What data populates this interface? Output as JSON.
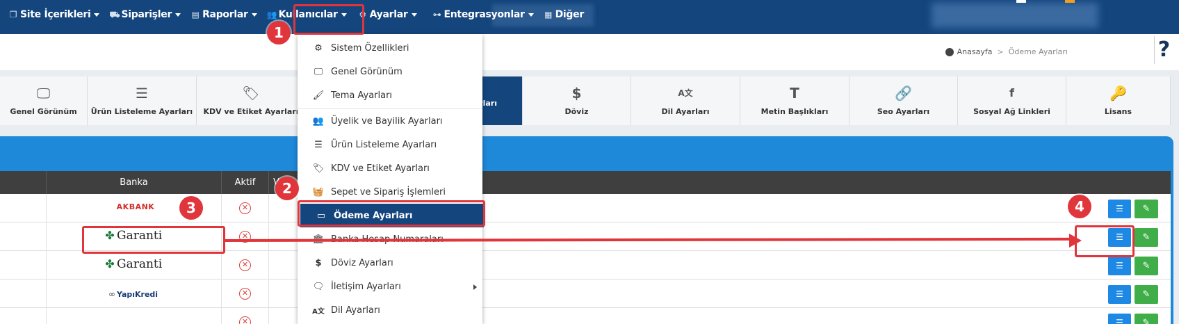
{
  "nav": {
    "items": [
      {
        "label": "Site İçerikleri",
        "icon": "copy-icon"
      },
      {
        "label": "Siparişler",
        "icon": "truck-icon"
      },
      {
        "label": "Raporlar",
        "icon": "file-icon"
      },
      {
        "label": "Kullanıcılar",
        "icon": "users-icon"
      },
      {
        "label": "Ayarlar",
        "icon": "cogs-icon"
      },
      {
        "label": "Entegrasyonlar",
        "icon": "sitemap-icon"
      },
      {
        "label": "Diğer",
        "icon": "grid-icon"
      }
    ]
  },
  "breadcrumb": {
    "home": "Anasayfa",
    "separator": ">",
    "current": "Ödeme Ayarları"
  },
  "help_label": "?",
  "tabs": [
    {
      "label": "Genel Görünüm",
      "icon": "monitor-icon"
    },
    {
      "label": "Ürün Listeleme Ayarları",
      "icon": "list-icon"
    },
    {
      "label": "KDV ve Etiket Ayarları",
      "icon": "tags-icon"
    },
    {
      "label": "",
      "icon": ""
    },
    {
      "label": "arları",
      "icon": ""
    },
    {
      "label": "Döviz",
      "icon": "dollar-icon"
    },
    {
      "label": "Dil Ayarları",
      "icon": "language-icon"
    },
    {
      "label": "Metin Başlıkları",
      "icon": "text-height-icon"
    },
    {
      "label": "Seo Ayarları",
      "icon": "link-icon"
    },
    {
      "label": "Sosyal Ağ Linkleri",
      "icon": "facebook-icon"
    },
    {
      "label": "Lisans",
      "icon": "key-icon"
    }
  ],
  "table": {
    "headers": [
      "",
      "Banka",
      "Aktif",
      "V"
    ],
    "rows": [
      {
        "bank": "AKBANK",
        "logo": "akbank-logo"
      },
      {
        "bank": "Garanti",
        "logo": "garanti-logo"
      },
      {
        "bank": "Garanti",
        "logo": "garanti-logo"
      },
      {
        "bank": "YapıKredi",
        "logo": "yapikredi-logo"
      },
      {
        "bank": "",
        "logo": "yellow-logo"
      }
    ]
  },
  "dropdown": {
    "items": [
      {
        "label": "Sistem Özellikleri",
        "icon": "cogs-icon"
      },
      {
        "label": "Genel Görünüm",
        "icon": "monitor-icon"
      },
      {
        "label": "Tema Ayarları",
        "icon": "brush-icon"
      },
      {
        "label": "Üyelik ve Bayilik Ayarları",
        "icon": "users-icon"
      },
      {
        "label": "Ürün Listeleme Ayarları",
        "icon": "list-icon"
      },
      {
        "label": "KDV ve Etiket Ayarları",
        "icon": "tags-icon"
      },
      {
        "label": "Sepet ve Sipariş İşlemleri",
        "icon": "basket-icon"
      },
      {
        "label": "Ödeme Ayarları",
        "icon": "credit-card-icon"
      },
      {
        "label": "Banka Hesap Numaraları",
        "icon": "bank-icon"
      },
      {
        "label": "Döviz Ayarları",
        "icon": "dollar-icon"
      },
      {
        "label": "İletişim Ayarları",
        "icon": "comments-icon"
      },
      {
        "label": "Dil Ayarları",
        "icon": "language-icon"
      }
    ]
  },
  "annotations": {
    "step1": "1",
    "step2": "2",
    "step3": "3",
    "step4": "4"
  },
  "colors": {
    "navbar": "#14457d",
    "accent": "#1e88d9",
    "highlight": "#e0353b",
    "edit": "#3fae49",
    "settings": "#1e88e5"
  }
}
